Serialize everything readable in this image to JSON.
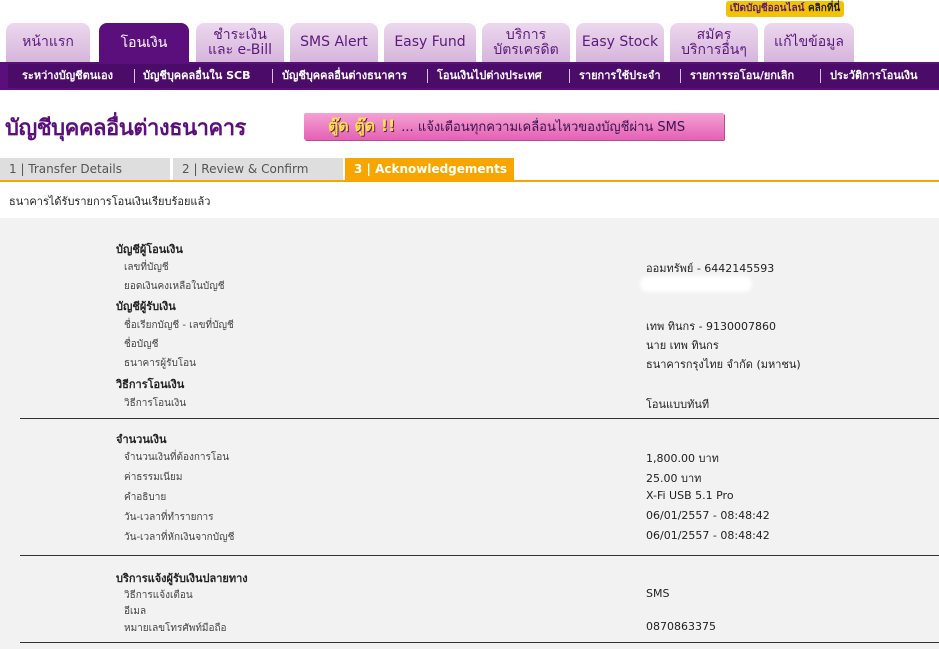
{
  "promo": {
    "label_plain": "เปิดบัญชีออนไลน์",
    "label_bold": "คลิกที่นี่"
  },
  "tabs": [
    {
      "line1": "หน้าแรก",
      "line2": ""
    },
    {
      "line1": "โอนเงิน",
      "line2": ""
    },
    {
      "line1": "ชำระเงิน",
      "line2": "และ e-Bill"
    },
    {
      "line1": "SMS Alert",
      "line2": ""
    },
    {
      "line1": "Easy Fund",
      "line2": ""
    },
    {
      "line1": "บริการ",
      "line2": "บัตรเครดิต"
    },
    {
      "line1": "Easy Stock",
      "line2": ""
    },
    {
      "line1": "สมัคร",
      "line2": "บริการอื่นๆ"
    },
    {
      "line1": "แก้ไขข้อมูล",
      "line2": ""
    }
  ],
  "subnav": [
    "ระหว่างบัญชีตนเอง",
    "บัญชีบุคคลอื่นใน SCB",
    "บัญชีบุคคลอื่นต่างธนาคาร",
    "โอนเงินไปต่างประเทศ",
    "รายการใช้ประจำ",
    "รายการรอโอน/ยกเลิก",
    "ประวัติการโอนเงิน"
  ],
  "page_title": "บัญชีบุคคลอื่นต่างธนาคาร",
  "banner": {
    "hot": "ตู๊ด ตู๊ด !!",
    "message": "... แจ้งเตือนทุกความเคลื่อนไหวของบัญชีผ่าน SMS"
  },
  "steps": [
    "1 | Transfer Details",
    "2 | Review & Confirm",
    "3 | Acknowledgements"
  ],
  "status_message": "ธนาคารได้รับรายการโอนเงินเรียบร้อยแล้ว",
  "receipt": {
    "from_header": "บัญชีผู้โอนเงิน",
    "account_no_label": "เลขที่บัญชี",
    "account_no_value": "ออมทรัพย์ - 6442145593",
    "balance_label": "ยอดเงินคงเหลือในบัญชี",
    "to_header": "บัญชีผู้รับเงิน",
    "nickname_label": "ชื่อเรียกบัญชี - เลขที่บัญชี",
    "nickname_value": "เทพ ทินกร - 9130007860",
    "account_name_label": "ชื่อบัญชี",
    "account_name_value": "นาย เทพ ทินกร",
    "bank_label": "ธนาคารผู้รับโอน",
    "bank_value": "ธนาคารกรุงไทย จำกัด (มหาชน)",
    "method_header": "วิธีการโอนเงิน",
    "method_label": "วิธีการโอนเงิน",
    "method_value": "โอนแบบทันที",
    "amount_header": "จำนวนเงิน",
    "amount_label": "จำนวนเงินที่ต้องการโอน",
    "amount_value": "1,800.00 บาท",
    "fee_label": "ค่าธรรมเนียม",
    "fee_value": "25.00  บาท",
    "desc_label": "คำอธิบาย",
    "desc_value": "X-Fi USB 5.1 Pro",
    "txn_time_label": "วัน-เวลาที่ทำรายการ",
    "txn_time_value": "06/01/2557 - 08:48:42",
    "debit_time_label": "วัน-เวลาที่หักเงินจากบัญชี",
    "debit_time_value": "06/01/2557 - 08:48:42",
    "notify_header": "บริการแจ้งผู้รับเงินปลายทาง",
    "notify_method_label": "วิธีการแจ้งเตือน",
    "notify_method_value": "SMS",
    "email_label": "อีเมล",
    "mobile_label": "หมายเลขโทรศัพท์มือถือ",
    "mobile_value": "0870863375"
  },
  "colors": {
    "brand_purple": "#5b0f7d",
    "accent_orange": "#f7a600",
    "tab_inactive": "#dcc0e1"
  }
}
